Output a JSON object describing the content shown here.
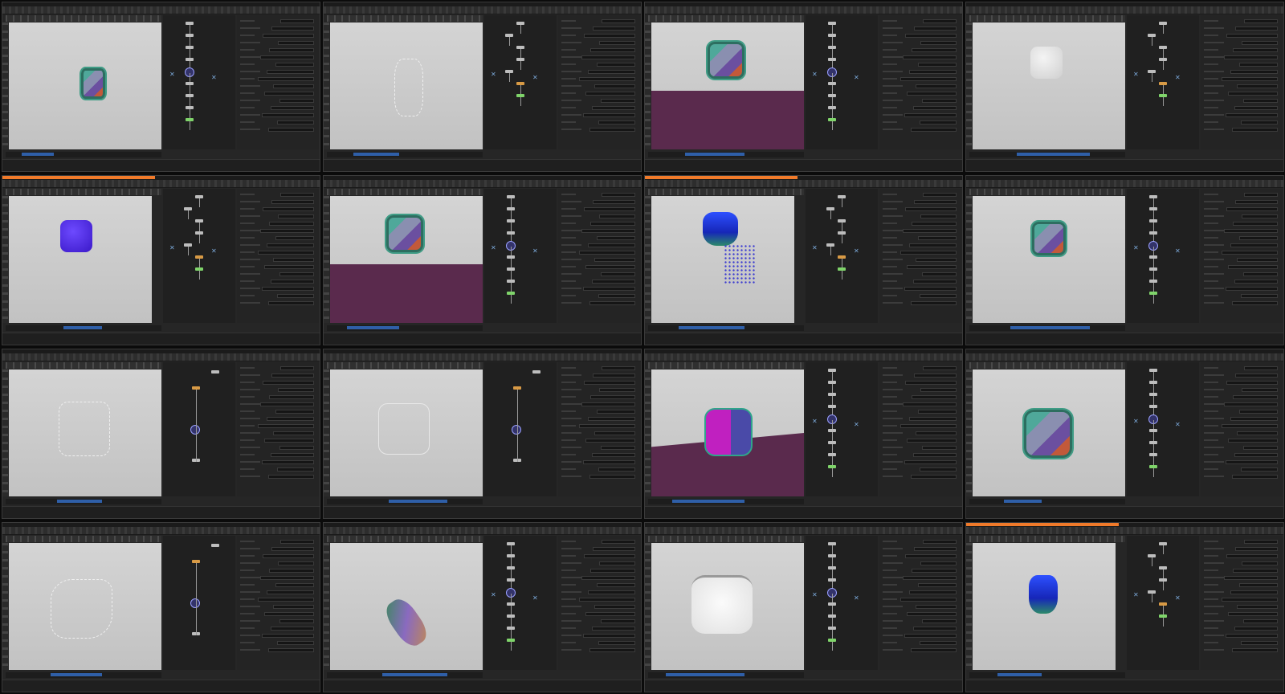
{
  "contact_sheet": {
    "frames": [
      {
        "scene": "mosaic-cube-small",
        "accent": false,
        "network": "chain"
      },
      {
        "scene": "wire-drops",
        "accent": false,
        "network": "branch"
      },
      {
        "scene": "mosaic-cube-floor",
        "accent": false,
        "network": "chain"
      },
      {
        "scene": "grey-cube",
        "accent": false,
        "network": "branch"
      },
      {
        "scene": "purple-cube",
        "accent": true,
        "network": "branch"
      },
      {
        "scene": "mosaic-cube-floor",
        "accent": false,
        "network": "chain"
      },
      {
        "scene": "blue-particles",
        "accent": true,
        "network": "branch"
      },
      {
        "scene": "mosaic-cube",
        "accent": false,
        "network": "chain"
      },
      {
        "scene": "wire-cube",
        "accent": false,
        "network": "diagonal"
      },
      {
        "scene": "wire-cube-soft",
        "accent": false,
        "network": "diagonal"
      },
      {
        "scene": "magenta-cube-floor",
        "accent": false,
        "network": "chain"
      },
      {
        "scene": "mosaic-cube-large",
        "accent": false,
        "network": "chain"
      },
      {
        "scene": "wire-crumpled",
        "accent": false,
        "network": "diagonal"
      },
      {
        "scene": "tilted-mosaic",
        "accent": false,
        "network": "chain"
      },
      {
        "scene": "white-cube",
        "accent": false,
        "network": "chain"
      },
      {
        "scene": "blue-deformed",
        "accent": true,
        "network": "branch"
      }
    ]
  },
  "colors": {
    "accent": "#f07a2a",
    "floor": "#5a2a4d",
    "node": "#bdbdbd",
    "node_green": "#7fd46a",
    "timeline_cursor": "#2f5fa8"
  }
}
